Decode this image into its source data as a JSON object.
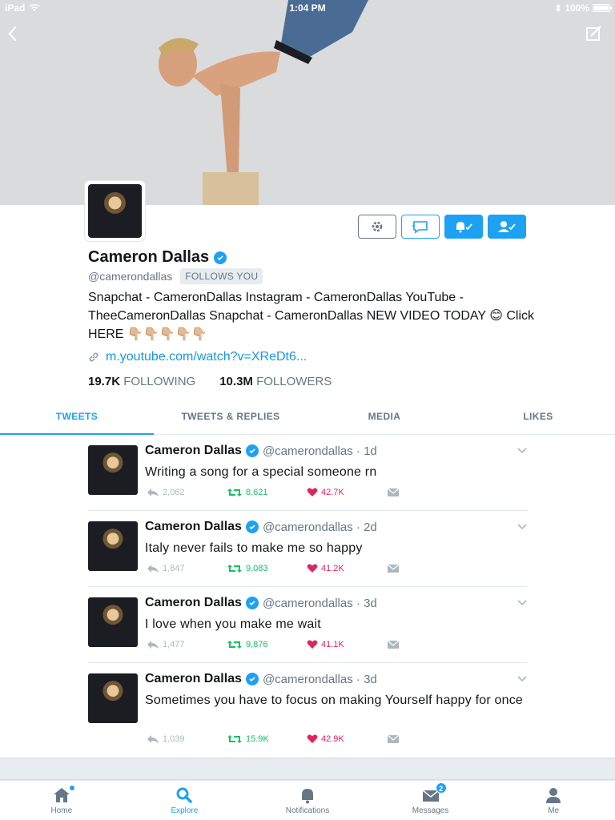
{
  "status_bar": {
    "device": "iPad",
    "time": "1:04 PM",
    "battery_label": "100%",
    "battery_level": 1.0
  },
  "header": {
    "back_icon": "chevron-left-icon",
    "edit_icon": "edit-icon"
  },
  "profile": {
    "name": "Cameron Dallas",
    "handle": "@camerondallas",
    "follows_you": "FOLLOWS YOU",
    "bio": "Snapchat - CameronDallas Instagram - CameronDallas YouTube - TheeCameronDallas Snapchat - CameronDallas NEW VIDEO TODAY 😊 Click HERE 👇🏼👇🏼👇🏼👇🏼👇🏼",
    "link": "m.youtube.com/watch?v=XReDt6...",
    "following_count": "19.7K",
    "following_label": "FOLLOWING",
    "followers_count": "10.3M",
    "followers_label": "FOLLOWERS"
  },
  "actions": {
    "settings_icon": "gear-icon",
    "dm_icon": "message-icon",
    "notify_icon": "bell-check-icon",
    "follow_icon": "user-check-icon"
  },
  "tabs": [
    {
      "label": "TWEETS",
      "active": true
    },
    {
      "label": "TWEETS & REPLIES",
      "active": false
    },
    {
      "label": "MEDIA",
      "active": false
    },
    {
      "label": "LIKES",
      "active": false
    }
  ],
  "tweets": [
    {
      "name": "Cameron Dallas",
      "handle": "@camerondallas",
      "time": "1d",
      "text": "Writing a song for a special someone rn",
      "replies": "2,062",
      "retweets": "8,621",
      "likes": "42.7K"
    },
    {
      "name": "Cameron Dallas",
      "handle": "@camerondallas",
      "time": "2d",
      "text": "Italy never fails to make me so happy",
      "replies": "1,847",
      "retweets": "9,083",
      "likes": "41.2K"
    },
    {
      "name": "Cameron Dallas",
      "handle": "@camerondallas",
      "time": "3d",
      "text": "I love when you make me wait",
      "replies": "1,477",
      "retweets": "9,876",
      "likes": "41.1K"
    },
    {
      "name": "Cameron Dallas",
      "handle": "@camerondallas",
      "time": "3d",
      "text": "Sometimes you have to focus on making Yourself happy for once",
      "replies": "1,039",
      "retweets": "15.9K",
      "likes": "42.9K"
    }
  ],
  "bottom_nav": [
    {
      "label": "Home",
      "icon": "home-icon",
      "active": false,
      "dot": true
    },
    {
      "label": "Explore",
      "icon": "search-icon",
      "active": true
    },
    {
      "label": "Notifications",
      "icon": "bell-icon",
      "active": false
    },
    {
      "label": "Messages",
      "icon": "mail-icon",
      "active": false,
      "badge": "2"
    },
    {
      "label": "Me",
      "icon": "person-icon",
      "active": false
    }
  ],
  "colors": {
    "accent": "#1da1f2",
    "retweet": "#17bf63",
    "like": "#e0245e",
    "muted": "#657786"
  }
}
